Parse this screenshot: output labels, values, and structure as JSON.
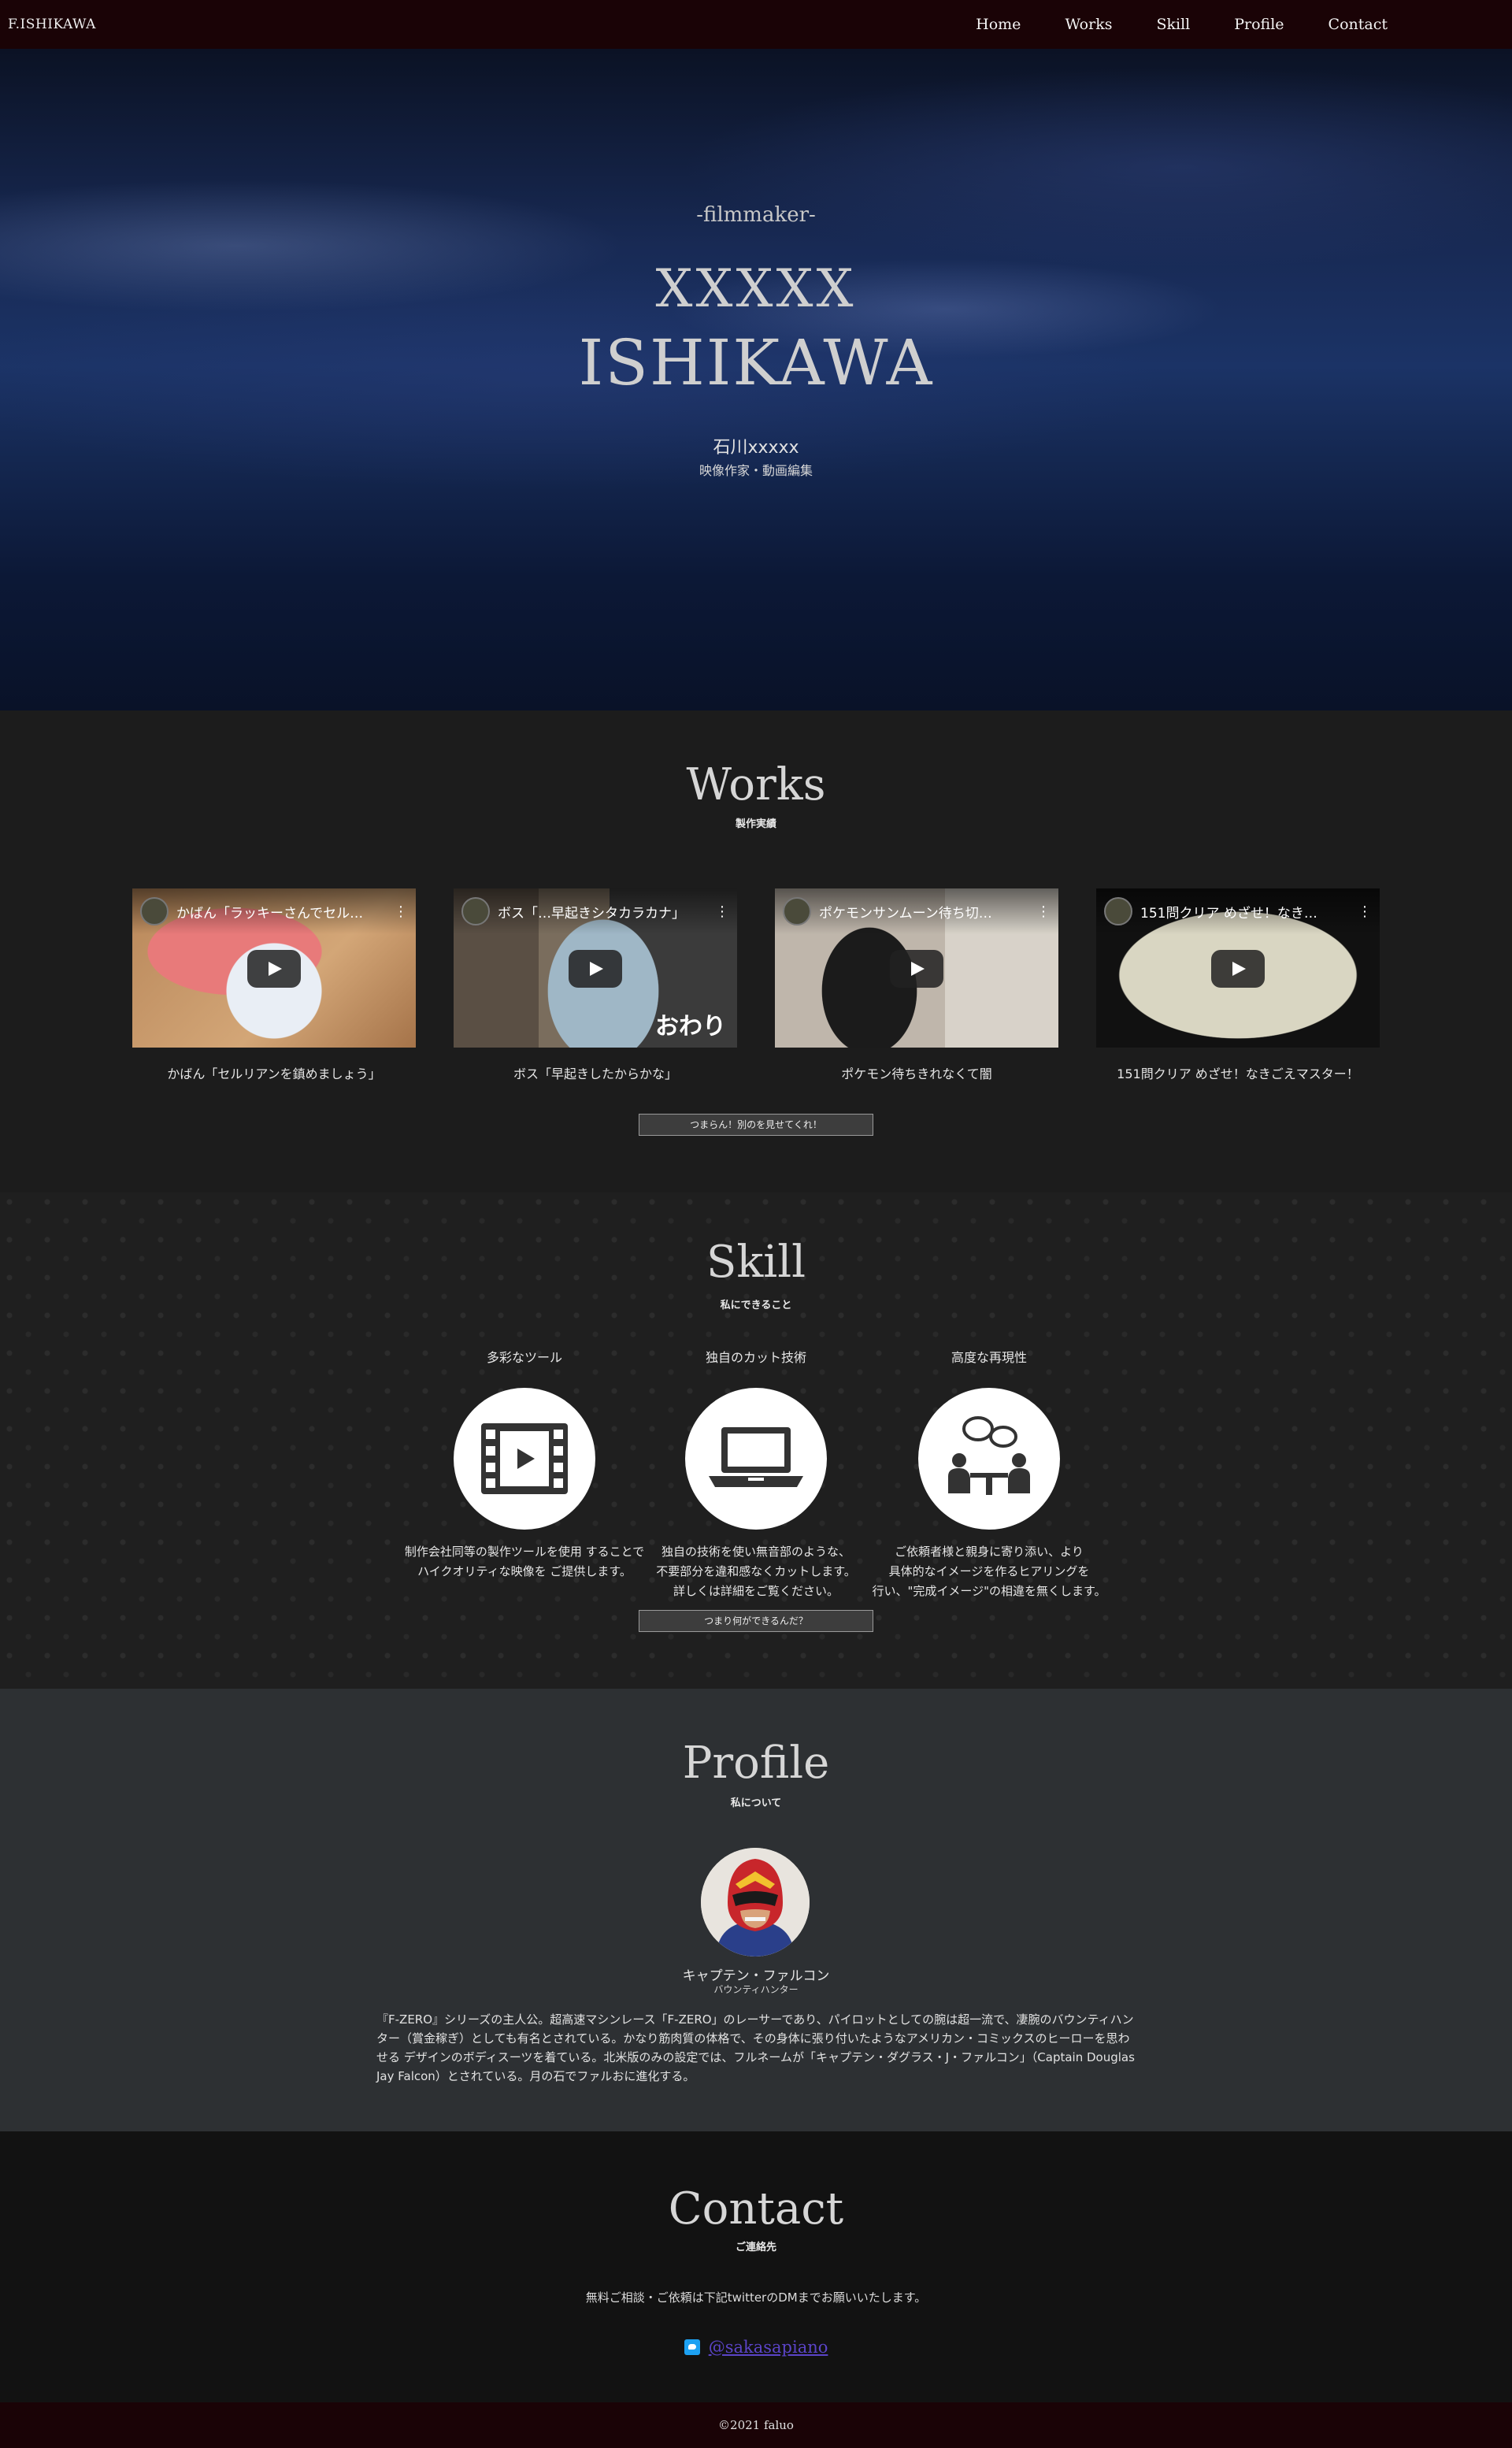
{
  "header": {
    "brand": "F.ISHIKAWA",
    "nav": [
      "Home",
      "Works",
      "Skill",
      "Profile",
      "Contact"
    ]
  },
  "hero": {
    "kicker": "-filmmaker-",
    "name_line1": "XXXXX",
    "name_line2": "ISHIKAWA",
    "name_jp": "石川xxxxx",
    "role": "映像作家・動画編集"
  },
  "works": {
    "title": "Works",
    "subtitle": "製作実績",
    "videos": [
      {
        "thumb_title": "かばん「ラッキーさんでセル…",
        "caption": "かばん「セルリアンを鎮めましょう」",
        "more": "⋮"
      },
      {
        "thumb_title": "ボス「…早起きシタカラカナ」",
        "caption": "ボス「早起きしたからかな」",
        "more": "⋮",
        "overlay": "おわり"
      },
      {
        "thumb_title": "ポケモンサンムーン待ち切…",
        "caption": "ポケモン待ちきれなくて闇",
        "more": "⋮"
      },
      {
        "thumb_title": "151問クリア めざせ！なき…",
        "caption": "151問クリア めざせ！なきごえマスター！",
        "more": "⋮"
      }
    ],
    "more_button": "つまらん！別のを見せてくれ！"
  },
  "skill": {
    "title": "Skill",
    "subtitle": "私にできること",
    "items": [
      {
        "label": "多彩なツール",
        "icon": "film-icon",
        "desc": [
          "制作会社同等の製作ツールを使用 することで",
          "ハイクオリティな映像を ご提供します。"
        ]
      },
      {
        "label": "独自のカット技術",
        "icon": "laptop-icon",
        "desc": [
          "独自の技術を使い無音部のような、",
          "不要部分を違和感なくカットします。",
          "詳しくは詳細をご覧ください。"
        ]
      },
      {
        "label": "高度な再現性",
        "icon": "meeting-icon",
        "desc": [
          "ご依頼者様と親身に寄り添い、より",
          "具体的なイメージを作るヒアリングを",
          "行い、\"完成イメージ\"の相違を無くします。"
        ]
      }
    ],
    "more_button": "つまり何ができるんだ？"
  },
  "profile": {
    "title": "Profile",
    "subtitle": "私について",
    "name": "キャプテン・ファルコン",
    "role": "バウンティハンター",
    "bio": "『F-ZERO』シリーズの主人公。超高速マシンレース「F-ZERO」のレーサーであり、パイロットとしての腕は超一流で、凄腕のバウンティハンター（賞金稼ぎ）としても有名とされている。かなり筋肉質の体格で、その身体に張り付いたようなアメリカン・コミックスのヒーローを思わせる デザインのボディスーツを着ている。北米版のみの設定では、フルネームが「キャプテン・ダグラス・J・ファルコン」（Captain Douglas Jay Falcon）とされている。月の石でファルおに進化する。"
  },
  "contact": {
    "title": "Contact",
    "subtitle": "ご連絡先",
    "text": "無料ご相談・ご依頼は下記twitterのDMまでお願いいたします。",
    "link": "@sakasapiano"
  },
  "footer": {
    "copyright": "©2021 faluo"
  }
}
